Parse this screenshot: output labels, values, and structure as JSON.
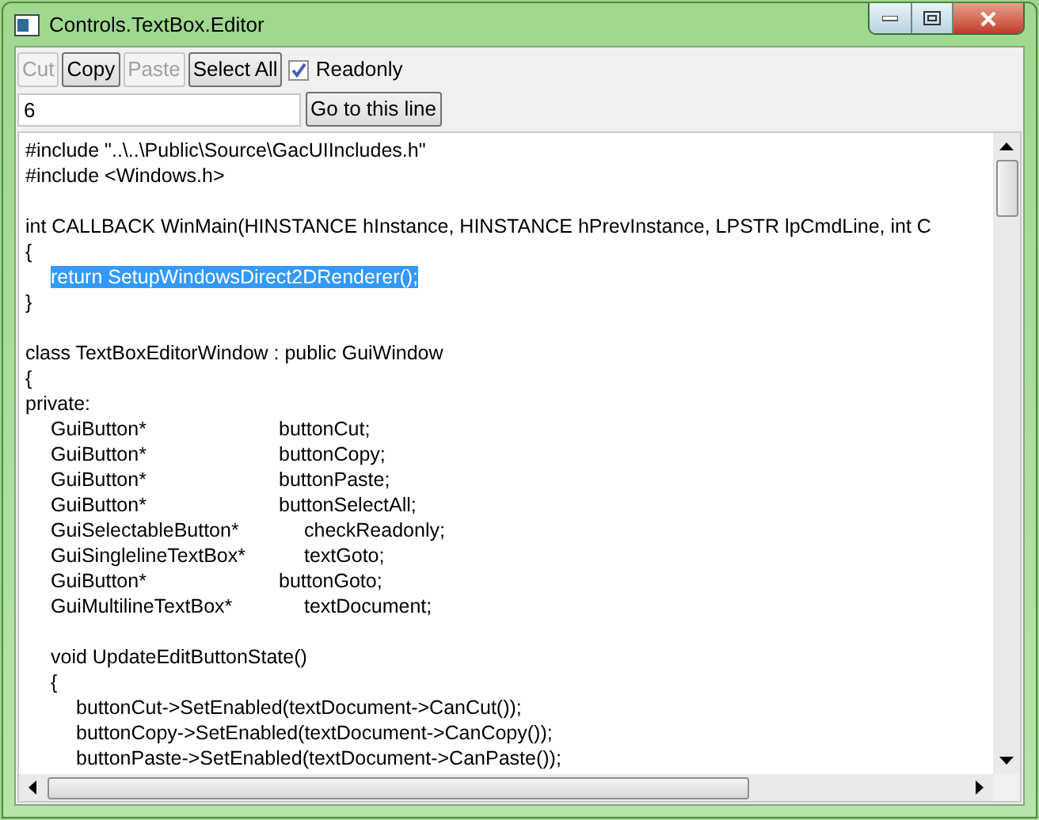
{
  "window": {
    "title": "Controls.TextBox.Editor"
  },
  "toolbar": {
    "buttons": [
      {
        "label": "Cut",
        "disabled": true
      },
      {
        "label": "Copy",
        "disabled": false
      },
      {
        "label": "Paste",
        "disabled": true
      },
      {
        "label": "Select All",
        "disabled": false
      }
    ],
    "readonly": {
      "label": "Readonly",
      "checked": true
    }
  },
  "goto": {
    "value": "6",
    "button": "Go to this line"
  },
  "editor": {
    "lines": [
      {
        "text": "#include \"..\\..\\Public\\Source\\GacUIIncludes.h\"",
        "selected": false
      },
      {
        "text": "#include <Windows.h>",
        "selected": false
      },
      {
        "kind": "blank",
        "selected": false
      },
      {
        "text": "int CALLBACK WinMain(HINSTANCE hInstance, HINSTANCE hPrevInstance, LPSTR lpCmdLine, int C",
        "selected": false
      },
      {
        "text": "{",
        "selected": false
      },
      {
        "text": "\treturn SetupWindowsDirect2DRenderer();",
        "selected": true
      },
      {
        "text": "}",
        "selected": false
      },
      {
        "kind": "blank",
        "selected": false
      },
      {
        "text": "class TextBoxEditorWindow : public GuiWindow",
        "selected": false
      },
      {
        "text": "{",
        "selected": false
      },
      {
        "text": "private:",
        "selected": false
      },
      {
        "text": "\tGuiButton*\t\t\t\t\t\tbuttonCut;",
        "selected": false
      },
      {
        "text": "\tGuiButton*\t\t\t\t\t\tbuttonCopy;",
        "selected": false
      },
      {
        "text": "\tGuiButton*\t\t\t\t\t\tbuttonPaste;",
        "selected": false
      },
      {
        "text": "\tGuiButton*\t\t\t\t\t\tbuttonSelectAll;",
        "selected": false
      },
      {
        "text": "\tGuiSelectableButton*\t\t\tcheckReadonly;",
        "selected": false
      },
      {
        "text": "\tGuiSinglelineTextBox*\t\t\ttextGoto;",
        "selected": false
      },
      {
        "text": "\tGuiButton*\t\t\t\t\t\tbuttonGoto;",
        "selected": false
      },
      {
        "text": "\tGuiMultilineTextBox*\t\t\ttextDocument;",
        "selected": false
      },
      {
        "kind": "blank",
        "selected": false
      },
      {
        "text": "\tvoid UpdateEditButtonState()",
        "selected": false
      },
      {
        "text": "\t{",
        "selected": false
      },
      {
        "text": "\t\tbuttonCut->SetEnabled(textDocument->CanCut());",
        "selected": false
      },
      {
        "text": "\t\tbuttonCopy->SetEnabled(textDocument->CanCopy());",
        "selected": false
      },
      {
        "text": "\t\tbuttonPaste->SetEnabled(textDocument->CanPaste());",
        "selected": false
      }
    ]
  }
}
